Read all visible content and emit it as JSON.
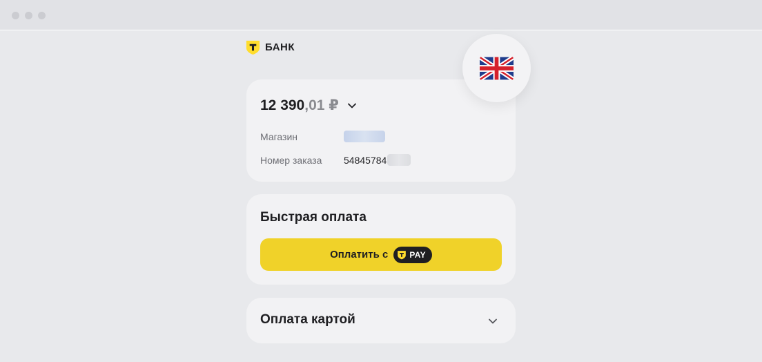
{
  "window": {
    "controls": [
      "close",
      "minimize",
      "maximize"
    ]
  },
  "brand": {
    "name": "БАНК",
    "logo_icon": "t-shield-logo",
    "color": "#ffdd2d"
  },
  "language": {
    "icon": "uk-flag-icon",
    "current": "English"
  },
  "summary": {
    "amount_main": "12 390",
    "amount_cents": ",01 ₽",
    "store_label": "Магазин",
    "order_label": "Номер заказа",
    "order_value": "54845784"
  },
  "fast_pay": {
    "title": "Быстрая оплата",
    "button_label": "Оплатить с",
    "badge_label": "PAY",
    "button_color": "#f0d229"
  },
  "card_pay": {
    "title": "Оплата картой"
  }
}
